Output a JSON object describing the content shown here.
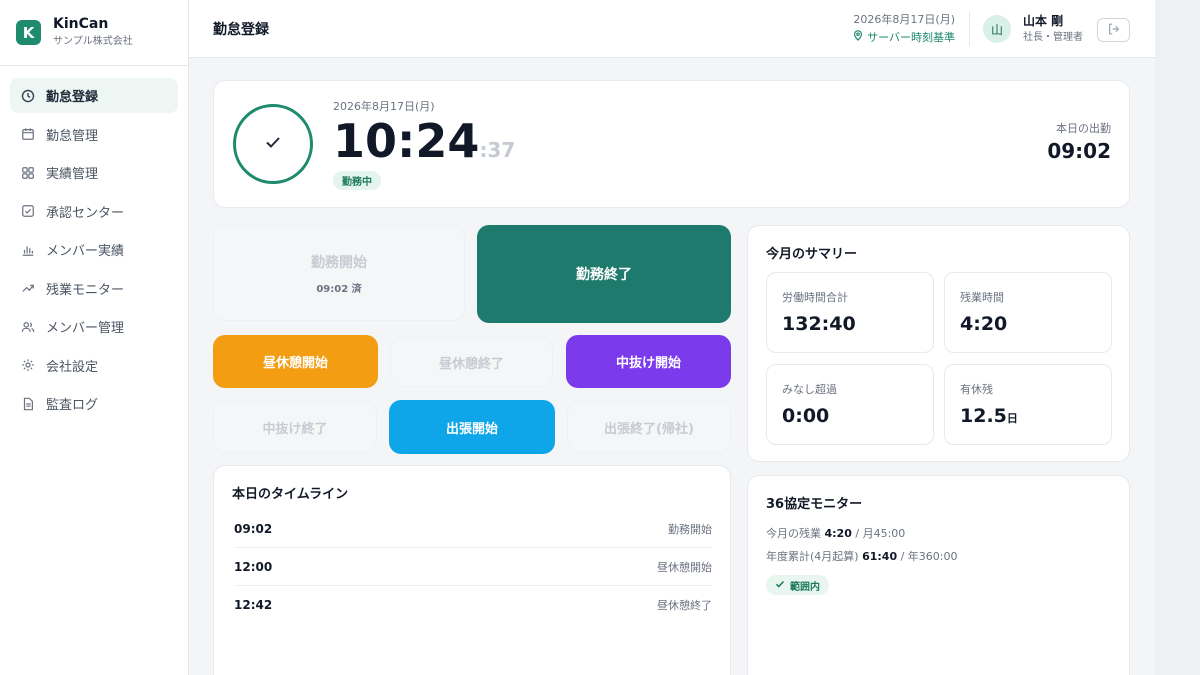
{
  "brand": {
    "name": "KinCan",
    "company": "サンプル株式会社",
    "logo_letter": "K"
  },
  "nav": {
    "items": [
      {
        "label": "勤怠登録",
        "icon": "clock-icon",
        "active": true
      },
      {
        "label": "勤怠管理",
        "icon": "calendar-icon"
      },
      {
        "label": "実績管理",
        "icon": "grid-icon"
      },
      {
        "label": "承認センター",
        "icon": "check-square-icon"
      },
      {
        "label": "メンバー実績",
        "icon": "bar-chart-icon"
      },
      {
        "label": "残業モニター",
        "icon": "trend-up-icon"
      },
      {
        "label": "メンバー管理",
        "icon": "users-icon"
      },
      {
        "label": "会社設定",
        "icon": "sun-gear-icon"
      },
      {
        "label": "監査ログ",
        "icon": "document-icon"
      }
    ]
  },
  "header": {
    "title": "勤怠登録",
    "date": "2026年8月17日(月)",
    "server_time": "サーバー時刻基準",
    "avatar": "山",
    "user_name": "山本 剛",
    "user_role": "社長・管理者"
  },
  "clock": {
    "date": "2026年8月17日(月)",
    "time": "10:24",
    "seconds": ":37",
    "status": "勤務中",
    "checkin_label": "本日の出勤",
    "checkin_time": "09:02"
  },
  "buttons": {
    "work_start": "勤務開始",
    "work_start_sub": "09:02 済",
    "work_end": "勤務終了",
    "lunch_start": "昼休憩開始",
    "lunch_end": "昼休憩終了",
    "out_start": "中抜け開始",
    "out_end": "中抜け終了",
    "trip_start": "出張開始",
    "trip_end": "出張終了(帰社)"
  },
  "summary": {
    "title": "今月のサマリー",
    "stats": [
      {
        "label": "労働時間合計",
        "value": "132:40",
        "unit": ""
      },
      {
        "label": "残業時間",
        "value": "4:20",
        "unit": ""
      },
      {
        "label": "みなし超過",
        "value": "0:00",
        "unit": ""
      },
      {
        "label": "有休残",
        "value": "12.5",
        "unit": "日"
      }
    ]
  },
  "timeline": {
    "title": "本日のタイムライン",
    "rows": [
      {
        "time": "09:02",
        "label": "勤務開始"
      },
      {
        "time": "12:00",
        "label": "昼休憩開始"
      },
      {
        "time": "12:42",
        "label": "昼休憩終了"
      }
    ]
  },
  "monitor": {
    "title": "36協定モニター",
    "line1_prefix": "今月の残業 ",
    "line1_value": "4:20",
    "line1_suffix": " / 月45:00",
    "line2_prefix": "年度累計(4月起算) ",
    "line2_value": "61:40",
    "line2_suffix": " / 年360:00",
    "status": "範囲内"
  },
  "colors": {
    "brand": "#1e8a6e",
    "work_end": "#1d7a6c",
    "lunch_start": "#f29d12",
    "out_start": "#7c3aed",
    "trip_start": "#0ea5e9"
  }
}
